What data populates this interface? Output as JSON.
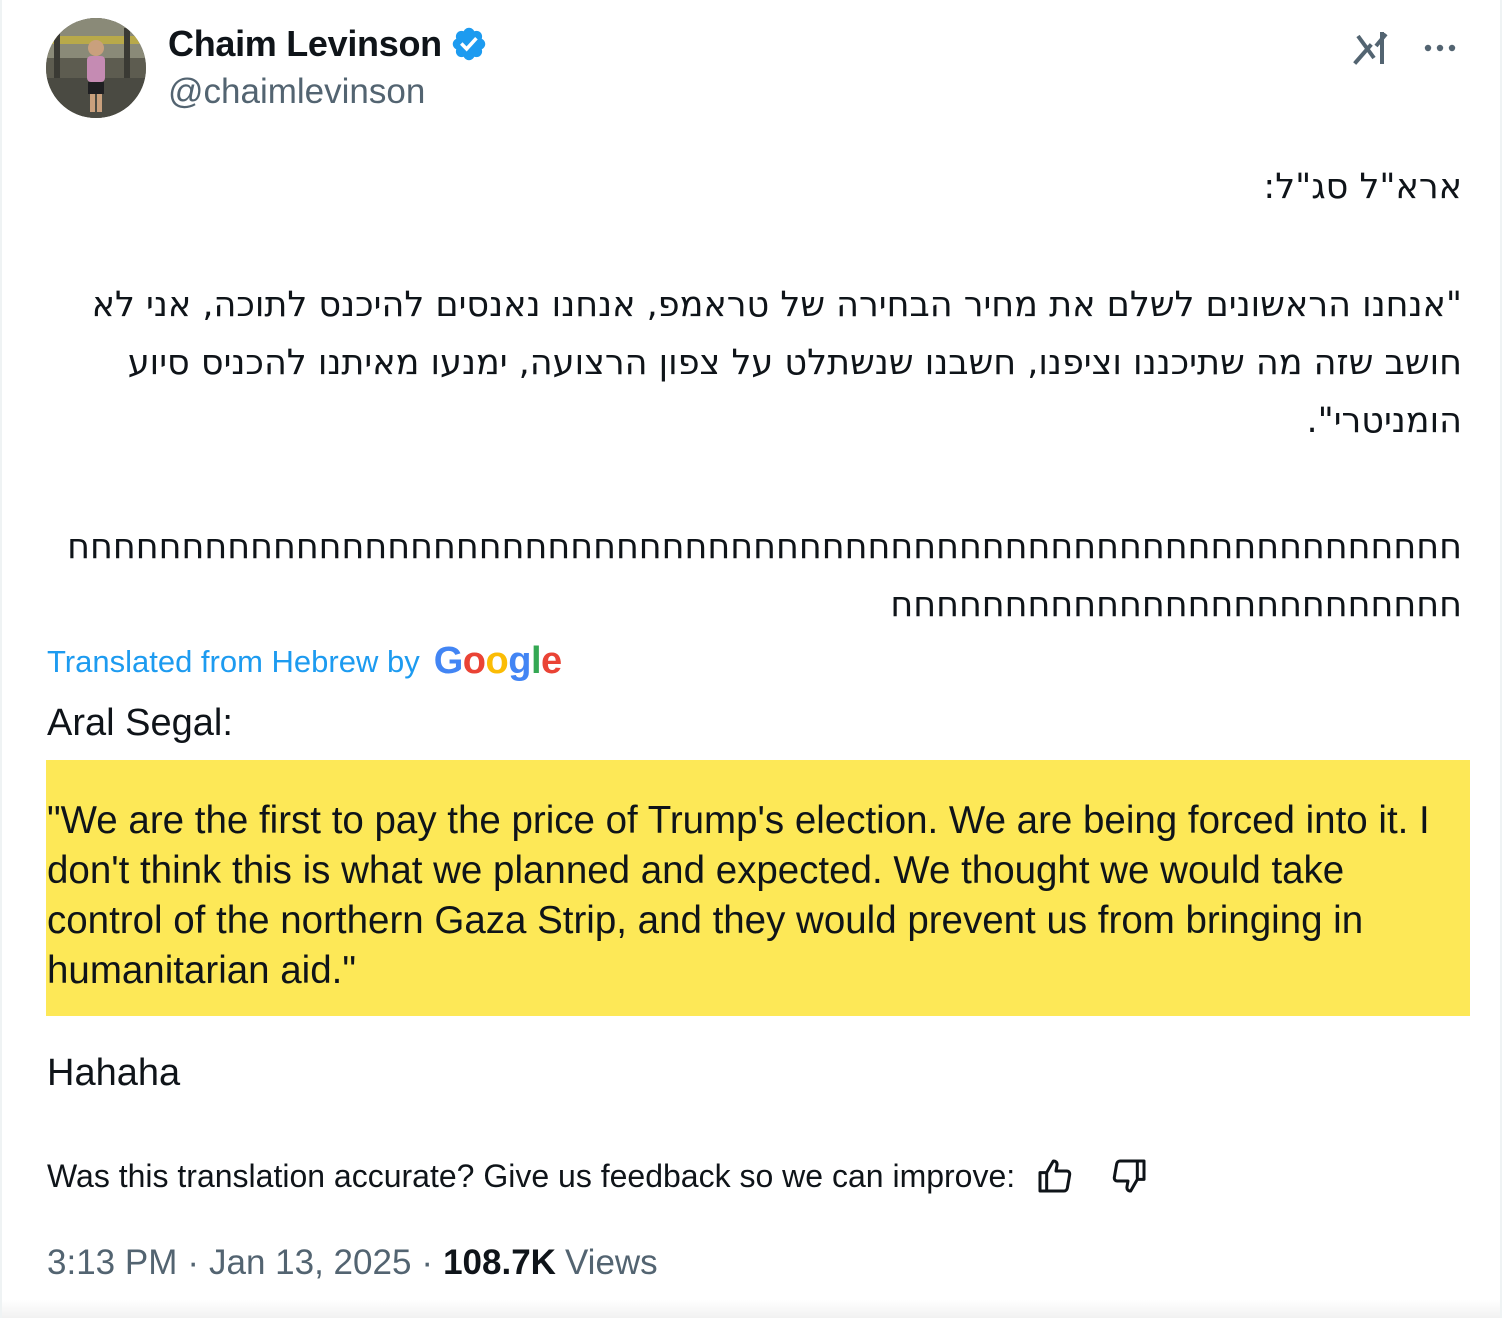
{
  "author": {
    "display_name": "Chaim Levinson",
    "handle": "@chaimlevinson",
    "verified": true,
    "avatar": "person-gym-photo"
  },
  "top_actions": {
    "grok_icon": "grok-icon",
    "more_icon": "more-icon"
  },
  "tweet": {
    "hebrew_title": "ארא\"ל סג\"ל:",
    "hebrew_quote": "\"אנחנו הראשונים לשלם את מחיר הבחירה של טראמפ, אנחנו נאנסים להיכנס לתוכה, אני לא חושב שזה מה שתיכננו וציפנו, חשבנו שנשתלט על צפון הרצועה, ימנעו מאיתנו להכניס סיוע הומניטרי\".",
    "hebrew_laugh": "חחחחחחחחחחחחחחחחחחחחחחחחחחחחחחחחחחחחחחחחחחחחחחחחחחחחחחחחחחחחחחחחחחחחחחחחחחחחחחחחחחחחחח"
  },
  "translation": {
    "attribution": "Translated from Hebrew by",
    "provider": "Google",
    "title": "Aral Segal:",
    "quote": "\"We are the first to pay the price of Trump's election. We are being forced into it. I don't think this is what we planned and expected. We thought we would take control of the northern Gaza Strip, and they would prevent us from bringing in humanitarian aid.\"",
    "laugh": "Hahaha",
    "highlight_color": "#fde857"
  },
  "feedback": {
    "prompt": "Was this translation accurate? Give us feedback so we can improve:",
    "thumbs_up_icon": "thumbs-up-icon",
    "thumbs_down_icon": "thumbs-down-icon"
  },
  "meta": {
    "time": "3:13 PM",
    "separator": "·",
    "date": "Jan 13, 2025",
    "views_count": "108.7K",
    "views_label": "Views"
  },
  "colors": {
    "accent": "#1d9bf0",
    "secondary_text": "#536471",
    "primary_text": "#0f1419"
  }
}
